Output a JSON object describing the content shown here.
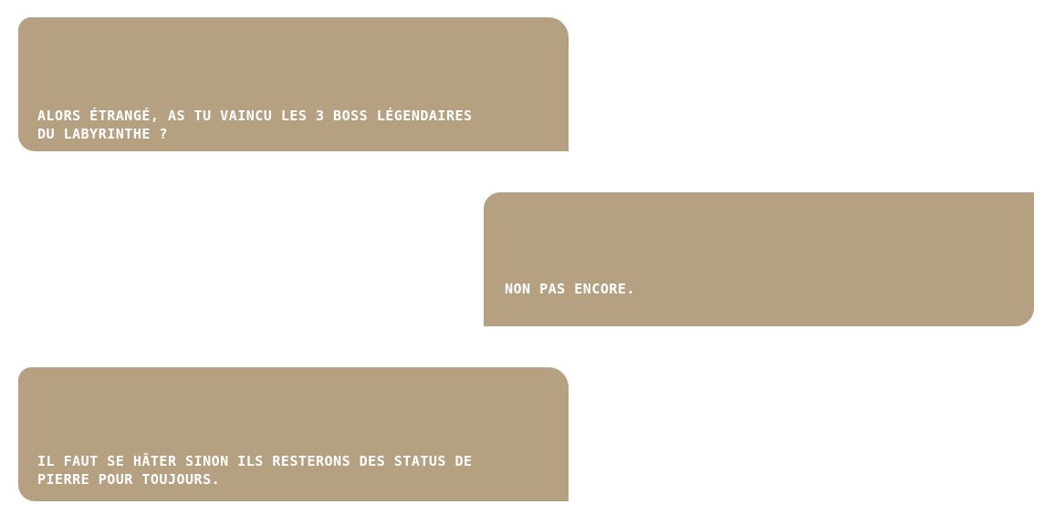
{
  "dialogue": [
    {
      "side": "left",
      "text": "Alors étrangé, as tu vaincu les 3 boss légendaires du labyrinthe ?"
    },
    {
      "side": "right",
      "text": "Non pas encore."
    },
    {
      "side": "left",
      "text": "Il faut se hâter sinon ils resterons des status de pierre pour toujours."
    }
  ],
  "colors": {
    "bubble": "#b5a182",
    "text": "#ffffff",
    "background": "#ffffff"
  }
}
